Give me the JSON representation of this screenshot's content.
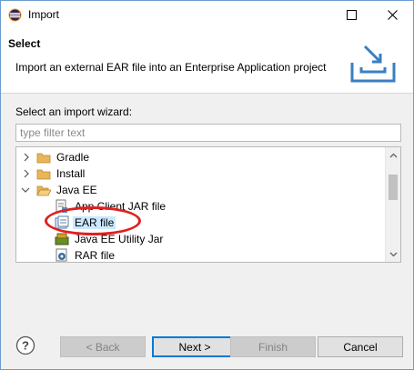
{
  "window": {
    "title": "Import",
    "icon": "eclipse-app-icon"
  },
  "header": {
    "title": "Select",
    "description": "Import an external EAR file into an Enterprise Application project",
    "graphic": "import-wizard-banner-icon"
  },
  "wizard": {
    "label": "Select an import wizard:",
    "filter_placeholder": "type filter text",
    "filter_value": "",
    "tree": [
      {
        "label": "Gradle",
        "type": "folder",
        "expanded": false,
        "level": 0
      },
      {
        "label": "Install",
        "type": "folder",
        "expanded": false,
        "level": 0
      },
      {
        "label": "Java EE",
        "type": "folder",
        "expanded": true,
        "level": 0
      },
      {
        "label": "App Client JAR file",
        "type": "item",
        "level": 1
      },
      {
        "label": "EAR file",
        "type": "item",
        "level": 1,
        "selected": true
      },
      {
        "label": "Java EE Utility Jar",
        "type": "item",
        "level": 1
      },
      {
        "label": "RAR file",
        "type": "item",
        "level": 1
      }
    ],
    "annotation_color": "#e02020"
  },
  "buttons": {
    "back": "< Back",
    "next": "Next >",
    "finish": "Finish",
    "cancel": "Cancel"
  },
  "colors": {
    "selection": "#cce8ff",
    "primary_border": "#0078d7"
  }
}
